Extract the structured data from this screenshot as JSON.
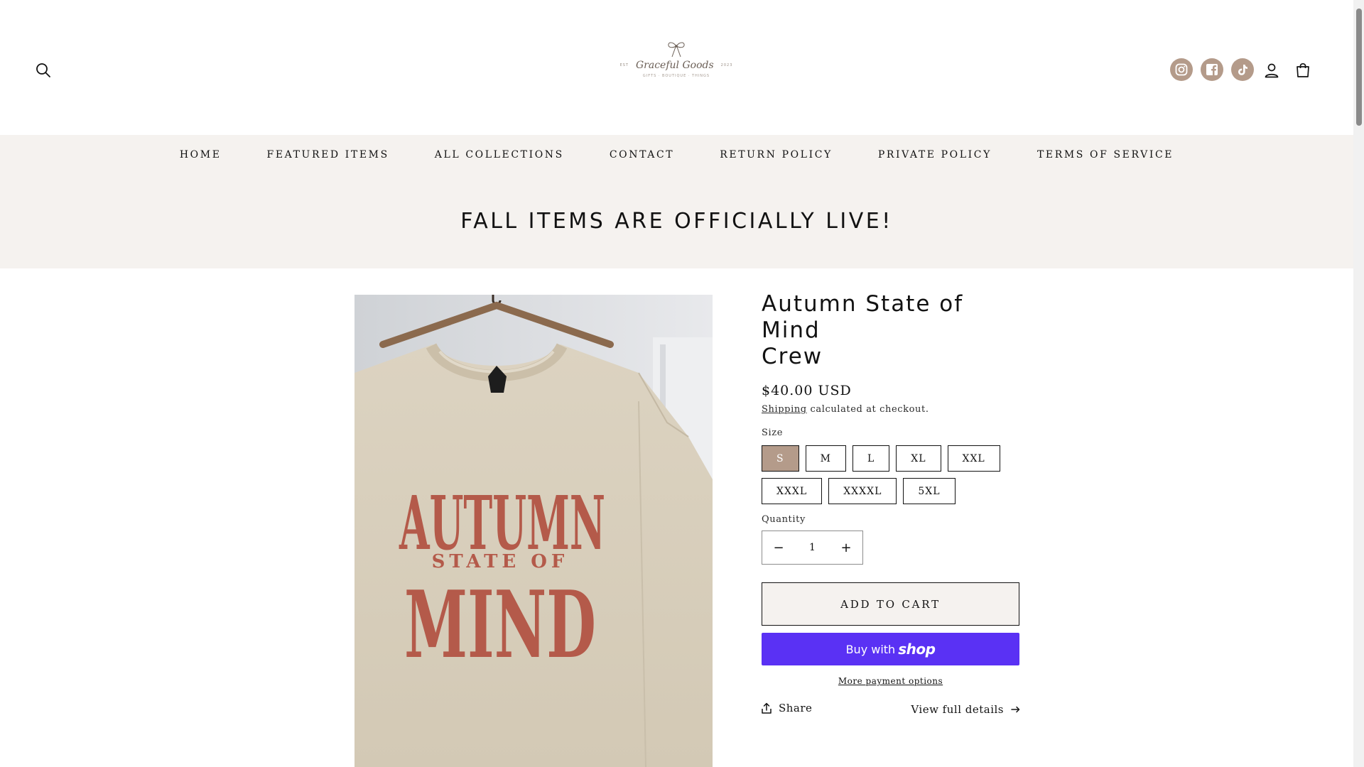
{
  "header": {
    "logo": {
      "est_left": "EST",
      "brand_name": "Graceful Goods",
      "est_right": "2023",
      "tagline": "GIFTS · BOUTIQUE · THINGS"
    },
    "icons": {
      "search": "search-icon",
      "instagram": "instagram-icon",
      "facebook": "facebook-icon",
      "tiktok": "tiktok-icon",
      "account": "account-icon",
      "cart": "cart-icon"
    },
    "social_color": "#b49b8a"
  },
  "nav": {
    "items": [
      {
        "label": "HOME"
      },
      {
        "label": "FEATURED ITEMS"
      },
      {
        "label": "ALL COLLECTIONS"
      },
      {
        "label": "CONTACT"
      },
      {
        "label": "RETURN POLICY"
      },
      {
        "label": "PRIVATE POLICY"
      },
      {
        "label": "TERMS OF SERVICE"
      }
    ]
  },
  "banner": {
    "text": "FALL ITEMS ARE OFFICIALLY LIVE!"
  },
  "product": {
    "title_line1": "Autumn State of Mind",
    "title_line2": "Crew",
    "price": "$40.00 USD",
    "shipping_link": "Shipping",
    "shipping_note": " calculated at checkout.",
    "size_label": "Size",
    "sizes": [
      {
        "label": "S",
        "selected": true
      },
      {
        "label": "M"
      },
      {
        "label": "L"
      },
      {
        "label": "XL"
      },
      {
        "label": "XXL"
      },
      {
        "label": "XXXL"
      },
      {
        "label": "XXXXL"
      },
      {
        "label": "5XL"
      }
    ],
    "quantity_label": "Quantity",
    "quantity_value": "1",
    "quantity_minus": "−",
    "quantity_plus": "+",
    "add_to_cart": "ADD TO CART",
    "buy_with": "Buy with",
    "shop_brand": "shop",
    "more_payment": "More payment options",
    "share": "Share",
    "view_full": "View full details",
    "image": {
      "print_line1": "AUTUMN",
      "print_line2": "STATE OF",
      "print_line3": "MIND",
      "shirt_color": "#d9cfbc",
      "print_color": "#b45a4a"
    },
    "accent_color": "#b49b8a",
    "shop_pay_color": "#5a31f4"
  }
}
